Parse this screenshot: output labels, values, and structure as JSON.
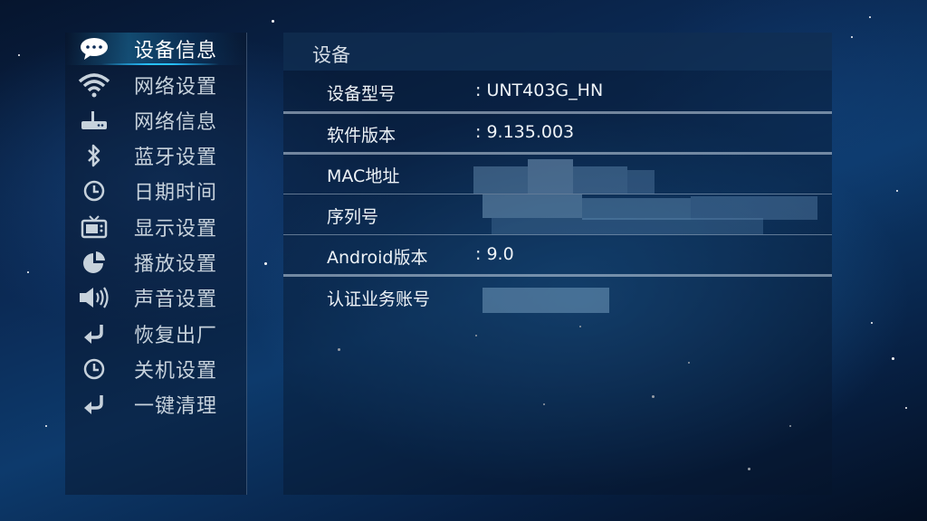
{
  "sidebar": {
    "items": [
      {
        "label": "设备信息",
        "icon": "chat-bubble-icon",
        "active": true
      },
      {
        "label": "网络设置",
        "icon": "wifi-icon",
        "active": false
      },
      {
        "label": "网络信息",
        "icon": "router-icon",
        "active": false
      },
      {
        "label": "蓝牙设置",
        "icon": "bluetooth-icon",
        "active": false
      },
      {
        "label": "日期时间",
        "icon": "clock-icon",
        "active": false
      },
      {
        "label": "显示设置",
        "icon": "tv-icon",
        "active": false
      },
      {
        "label": "播放设置",
        "icon": "pie-chart-icon",
        "active": false
      },
      {
        "label": "声音设置",
        "icon": "speaker-icon",
        "active": false
      },
      {
        "label": "恢复出厂",
        "icon": "return-arrow-icon",
        "active": false
      },
      {
        "label": "关机设置",
        "icon": "clock-icon",
        "active": false
      },
      {
        "label": "一键清理",
        "icon": "return-arrow-icon",
        "active": false
      }
    ]
  },
  "panel": {
    "title": "设备",
    "rows": [
      {
        "label": "设备型号",
        "value": ": UNT403G_HN"
      },
      {
        "label": "软件版本",
        "value": ": 9.135.003"
      },
      {
        "label": "MAC地址",
        "value": ""
      },
      {
        "label": "序列号",
        "value": ""
      },
      {
        "label": "Android版本",
        "value": ": 9.0"
      },
      {
        "label": "认证业务账号",
        "value": ""
      }
    ]
  },
  "colors": {
    "accent": "#27c0ff",
    "text": "#eef3f7",
    "sidebar_text": "#c7d2dc"
  }
}
